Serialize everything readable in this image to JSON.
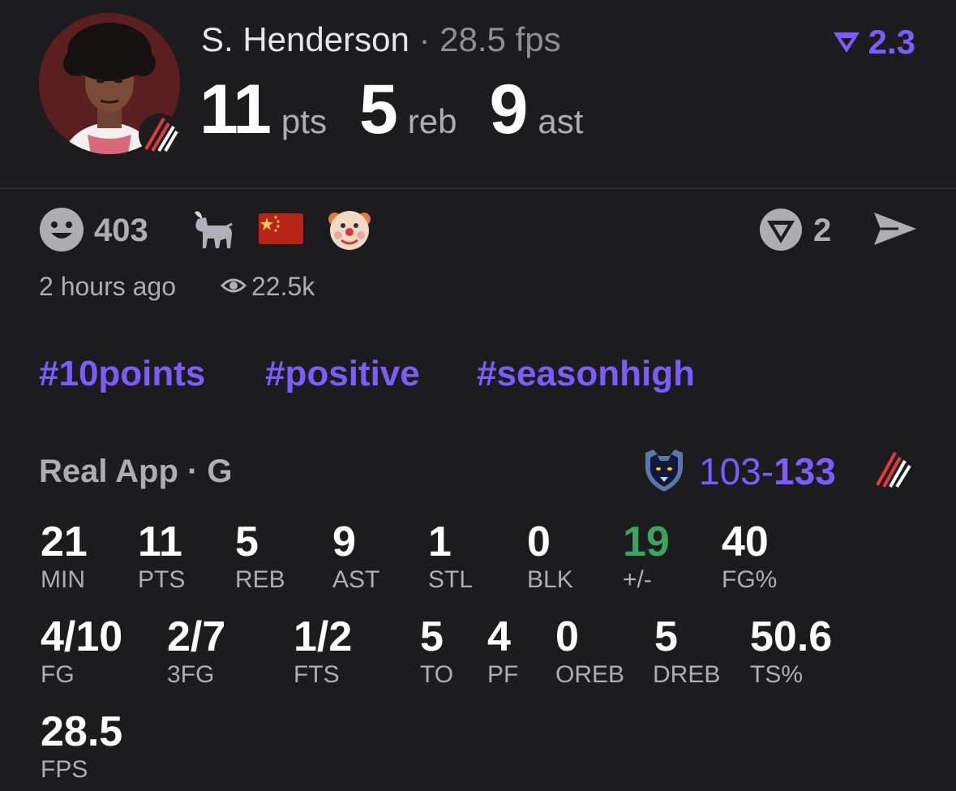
{
  "player": {
    "name": "S. Henderson",
    "separator": "·",
    "fps": "28.5 fps",
    "score_badge": "2.3",
    "statline": [
      {
        "value": "11",
        "unit": "pts"
      },
      {
        "value": "5",
        "unit": "reb"
      },
      {
        "value": "9",
        "unit": "ast"
      }
    ]
  },
  "reactions": {
    "count": "403",
    "votes": "2",
    "time": "2 hours ago",
    "views": "22.5k"
  },
  "hashtags": [
    "#10points",
    "#positive",
    "#seasonhigh"
  ],
  "game": {
    "label": "Real App · G",
    "away_score": "103",
    "dash": "-",
    "home_score": "133"
  },
  "stats": {
    "row1": [
      {
        "value": "21",
        "label": "MIN"
      },
      {
        "value": "11",
        "label": "PTS"
      },
      {
        "value": "5",
        "label": "REB"
      },
      {
        "value": "9",
        "label": "AST"
      },
      {
        "value": "1",
        "label": "STL"
      },
      {
        "value": "0",
        "label": "BLK"
      },
      {
        "value": "19",
        "label": "+/-"
      },
      {
        "value": "40",
        "label": "FG%"
      }
    ],
    "row2": [
      {
        "value": "4/10",
        "label": "FG"
      },
      {
        "value": "2/7",
        "label": "3FG"
      },
      {
        "value": "1/2",
        "label": "FTS"
      },
      {
        "value": "5",
        "label": "TO"
      },
      {
        "value": "4",
        "label": "PF"
      },
      {
        "value": "0",
        "label": "OREB"
      },
      {
        "value": "5",
        "label": "DREB"
      },
      {
        "value": "50.6",
        "label": "TS%"
      }
    ],
    "row3": [
      {
        "value": "28.5",
        "label": "FPS"
      }
    ]
  },
  "colors": {
    "background": "#1c1c1e",
    "accent": "#7d5cff",
    "positive": "#3ea35e",
    "muted": "#aeaeb2"
  },
  "icons": [
    "smiley-icon",
    "goat-icon",
    "china-flag-icon",
    "clown-icon",
    "vote-icon",
    "send-icon",
    "eye-icon",
    "grizzlies-logo",
    "trail-blazers-logo"
  ]
}
